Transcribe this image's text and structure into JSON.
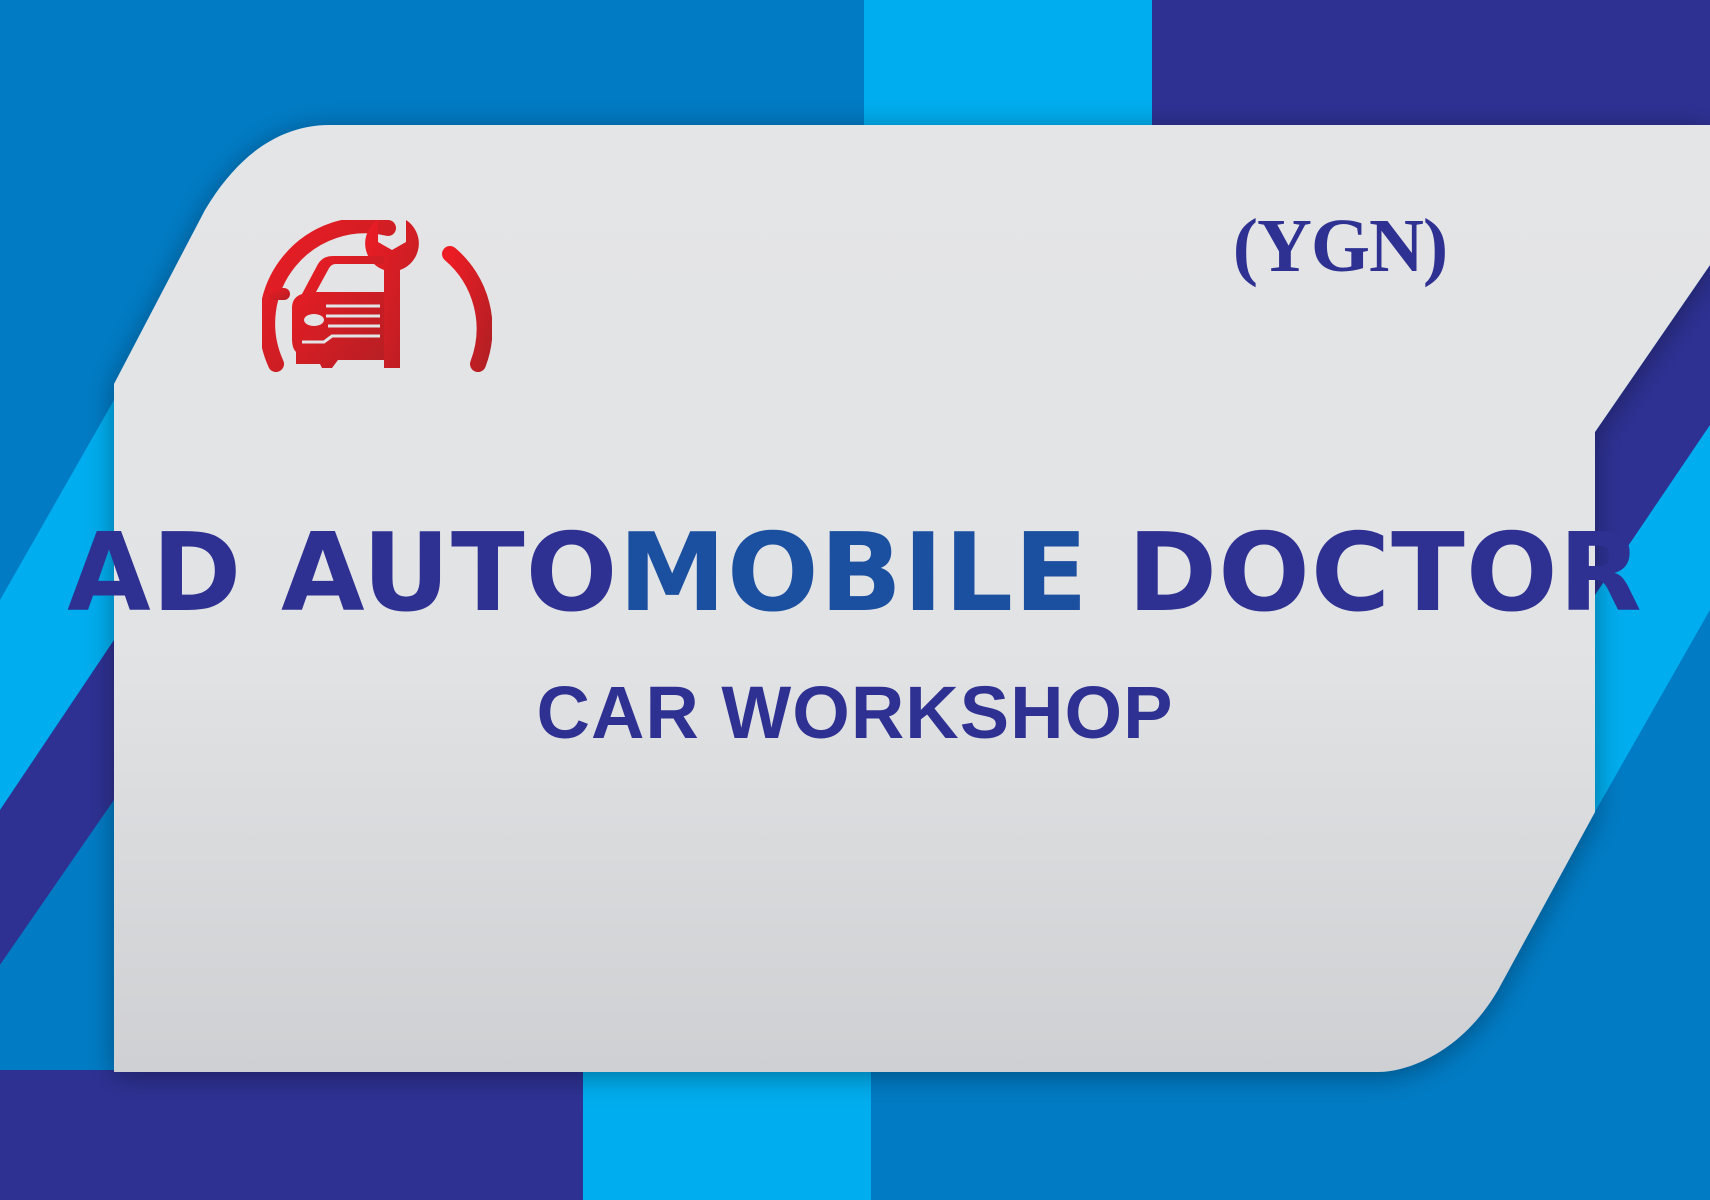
{
  "region_tag": "(YGN)",
  "title": {
    "part1": "AD AUTO",
    "part2": "MOBILE",
    "part3": " DOCTOR"
  },
  "subtitle": "CAR WORKSHOP",
  "logo_icon": "car-repair-wrench-icon",
  "colors": {
    "navy": "#2e3192",
    "medium_blue": "#017bc4",
    "sky_blue": "#00adee",
    "panel": "#e3e4e6",
    "logo_red": "#e31e24",
    "text_navy": "#2e3192",
    "text_accent_blue": "#1b4fa0"
  }
}
